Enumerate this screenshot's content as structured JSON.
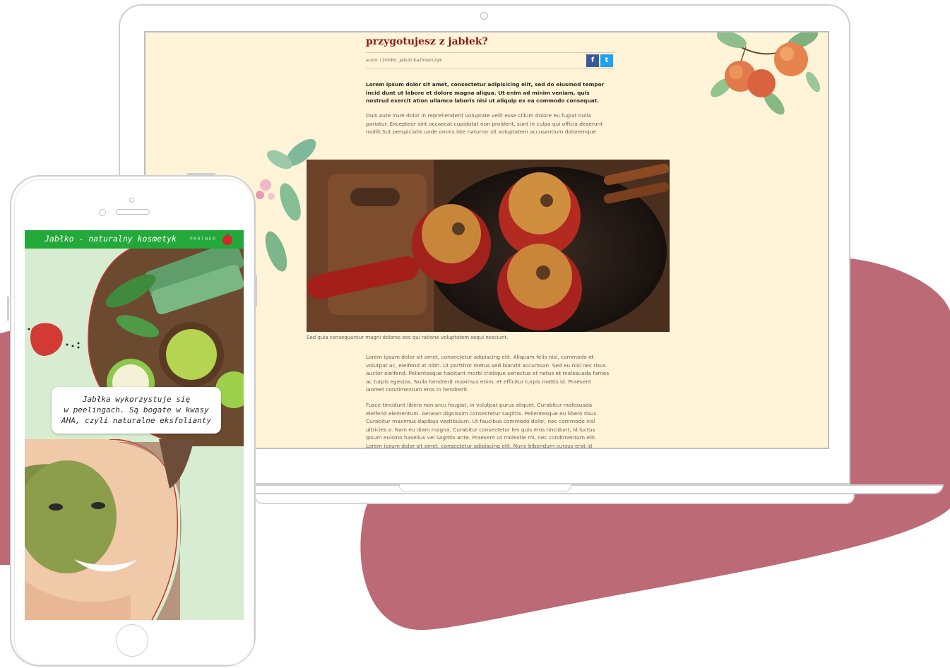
{
  "colors": {
    "blob": "#bd6a77",
    "laptop_screen_bg": "#fff3d8",
    "article_title": "#8e1b1b",
    "phone_header": "#23a83a",
    "phone_bg": "#d7ecd0"
  },
  "article": {
    "title": "przygotujesz z jabłek?",
    "byline": "autor i źródło: Jakub Kaźmierczyk",
    "lead": "Lorem ipsum dolor sit amet, consectetur adipisicing elit, sed do eiusmod tempor incid dunt ut labore et dolore magna aliqua. Ut enim ad minim veniam, quis nostrud exercit ation ullamco laboris nisi ut aliquip ex ea commodo consequat.",
    "para1": "Duis aute irure dolor in reprehenderit  voluptate velit esse cillum dolore eu fugiat nulla pariatur. Excepteur sint occaecat cupidatat non proident, sunt in culpa qui officia deserunt mollit.Sut perspiciatis unde omnis iste naturror sit voluptatem accusantium doloremque",
    "caption": "Sed quia consequuntur magni dolores eos qui ratione voluptatem sequi nesciunt.",
    "para2": "Lorem ipsum dolor sit amet, consectetur adipiscing elit. Aliquam felis nisl, commodo et volutpat ac, eleifend at nibh. Ut porttitor metus sed blandit accumsan. Sed eu nisi nec risus auctor eleifend. Pellentesque habitant morbi tristique senectus et netus et malesuada fames ac turpis egestas. Nulla hendrerit maximus enim, et efficitur turpis mattis id. Praesent laoreet condimentum eros in hendrerit.",
    "para3": "Fusce tincidunt libero non arcu feugiat, in volutpat purus aliquet. Curabitur malesuada eleifend elementum. Aenean dignissim consectetur sagittis. Pellentesque eu libero risus. Curabitur maximus dapibus vestibulum. Ut faucibus commodo dolor, nec commodo nisl ultricies a. Nam eu diam magna. Curabitur consectetur leo quis eros tincidunt, id luctus ipsum euismo hasellus vel sagittis ante. Praesent ut molestie mi, nec condimentum elit. Lorem ipsum dolor sit amet, consectetur adipiscing elit. Nunc bibendum cursus erat id",
    "share_facebook": "f",
    "share_twitter": "t",
    "icons": [
      "facebook-icon",
      "twitter-icon"
    ]
  },
  "phone": {
    "title": "Jabłko - naturalny kosmetyk",
    "partner": "PARTNER",
    "card_line1": "Jabłka wykorzystuje się",
    "card_line2": "w peelingach. Są bogate w kwasy",
    "card_line3": "AHA, czyli naturalne eksfolianty",
    "icons": [
      "apple-logo-icon",
      "strawberry-icon"
    ]
  }
}
